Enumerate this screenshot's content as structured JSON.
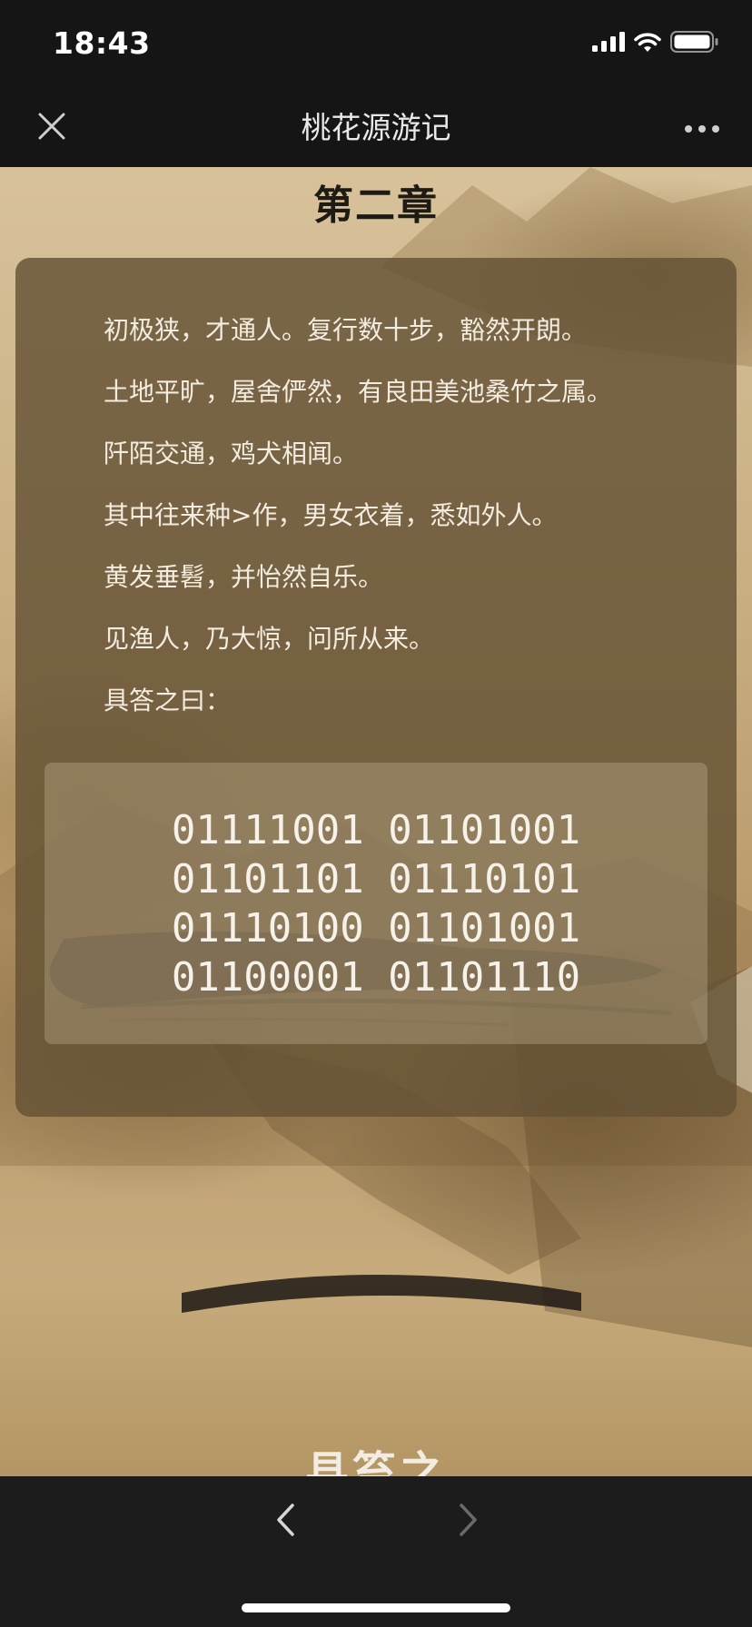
{
  "status_bar": {
    "time": "18:43",
    "icons": [
      "signal-icon",
      "wifi-icon",
      "battery-icon"
    ]
  },
  "nav_bar": {
    "title": "桃花源游记",
    "left_icon": "close-icon",
    "right_icon": "more-icon"
  },
  "content": {
    "chapter_title": "第二章",
    "poem_lines": [
      "初极狭，才通人。复行数十步，豁然开朗。",
      "土地平旷，屋舍俨然，有良田美池桑竹之属。",
      "阡陌交通，鸡犬相闻。",
      "其中往来种>作，男女衣着，悉如外人。",
      "黄发垂髫，并怡然自乐。",
      "见渔人，乃大惊，问所从来。",
      "具答之曰："
    ],
    "binary_lines": [
      "01111001 01101001",
      "01101101 01110101",
      "01110100 01101001",
      "01100001 01101110"
    ],
    "next_heading_partial": "县笞之"
  },
  "bottom_bar": {
    "back_icon": "chevron-left-icon",
    "forward_icon": "chevron-right-icon",
    "forward_enabled": false
  },
  "colors": {
    "bar_background": "#151515",
    "panel_background": "#645234",
    "text_light": "#f3ece0",
    "chapter_title": "#1e1a14"
  }
}
